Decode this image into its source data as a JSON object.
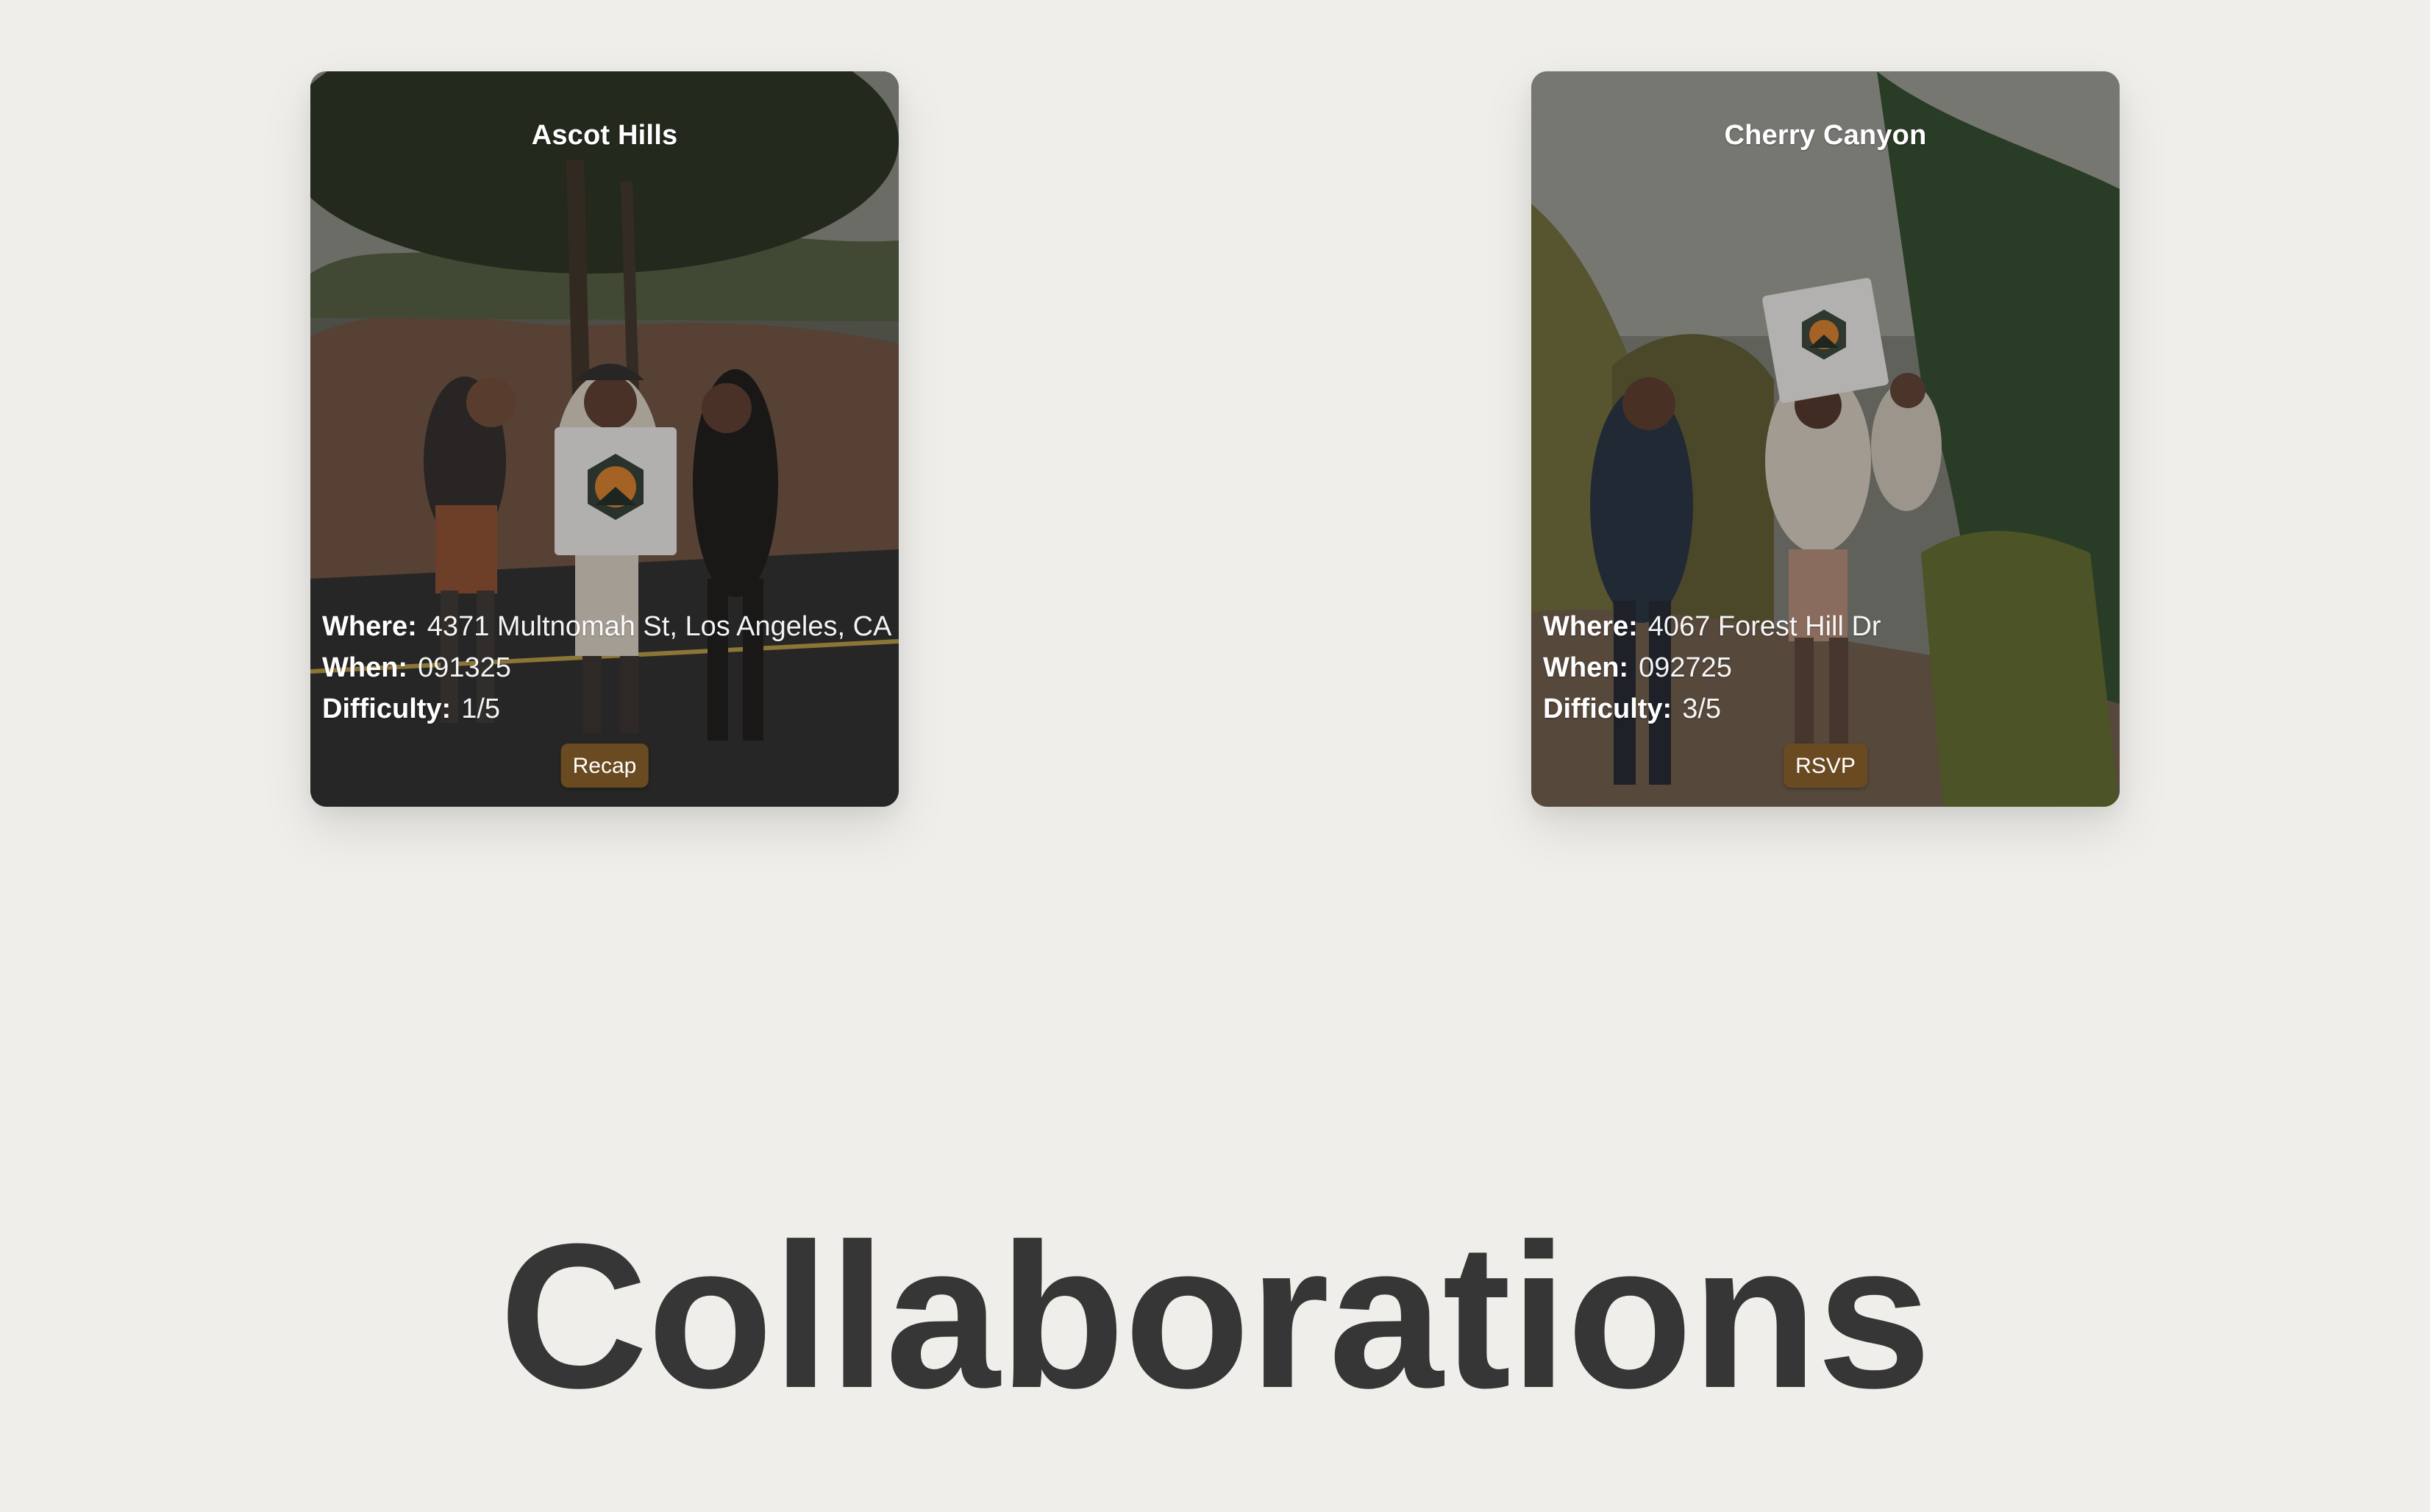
{
  "cards": [
    {
      "title": "Ascot Hills",
      "where_label": "Where:",
      "where_value": "4371 Multnomah St, Los Angeles, CA",
      "when_label": "When:",
      "when_value": "091325",
      "difficulty_label": "Difficulty:",
      "difficulty_value": "1/5",
      "button_label": "Recap",
      "photo": "group-hikers-holding-sign-photo"
    },
    {
      "title": "Cherry Canyon",
      "where_label": "Where:",
      "where_value": "4067 Forest Hill Dr",
      "when_label": "When:",
      "when_value": "092725",
      "difficulty_label": "Difficulty:",
      "difficulty_value": "3/5",
      "button_label": "RSVP",
      "photo": "hikers-on-trail-photo"
    }
  ],
  "section": {
    "heading": "Collaborations"
  },
  "colors": {
    "page_background": "#efeeea",
    "heading_text": "#363636",
    "button_background": "#6a4a21",
    "card_text": "#ffffff"
  }
}
